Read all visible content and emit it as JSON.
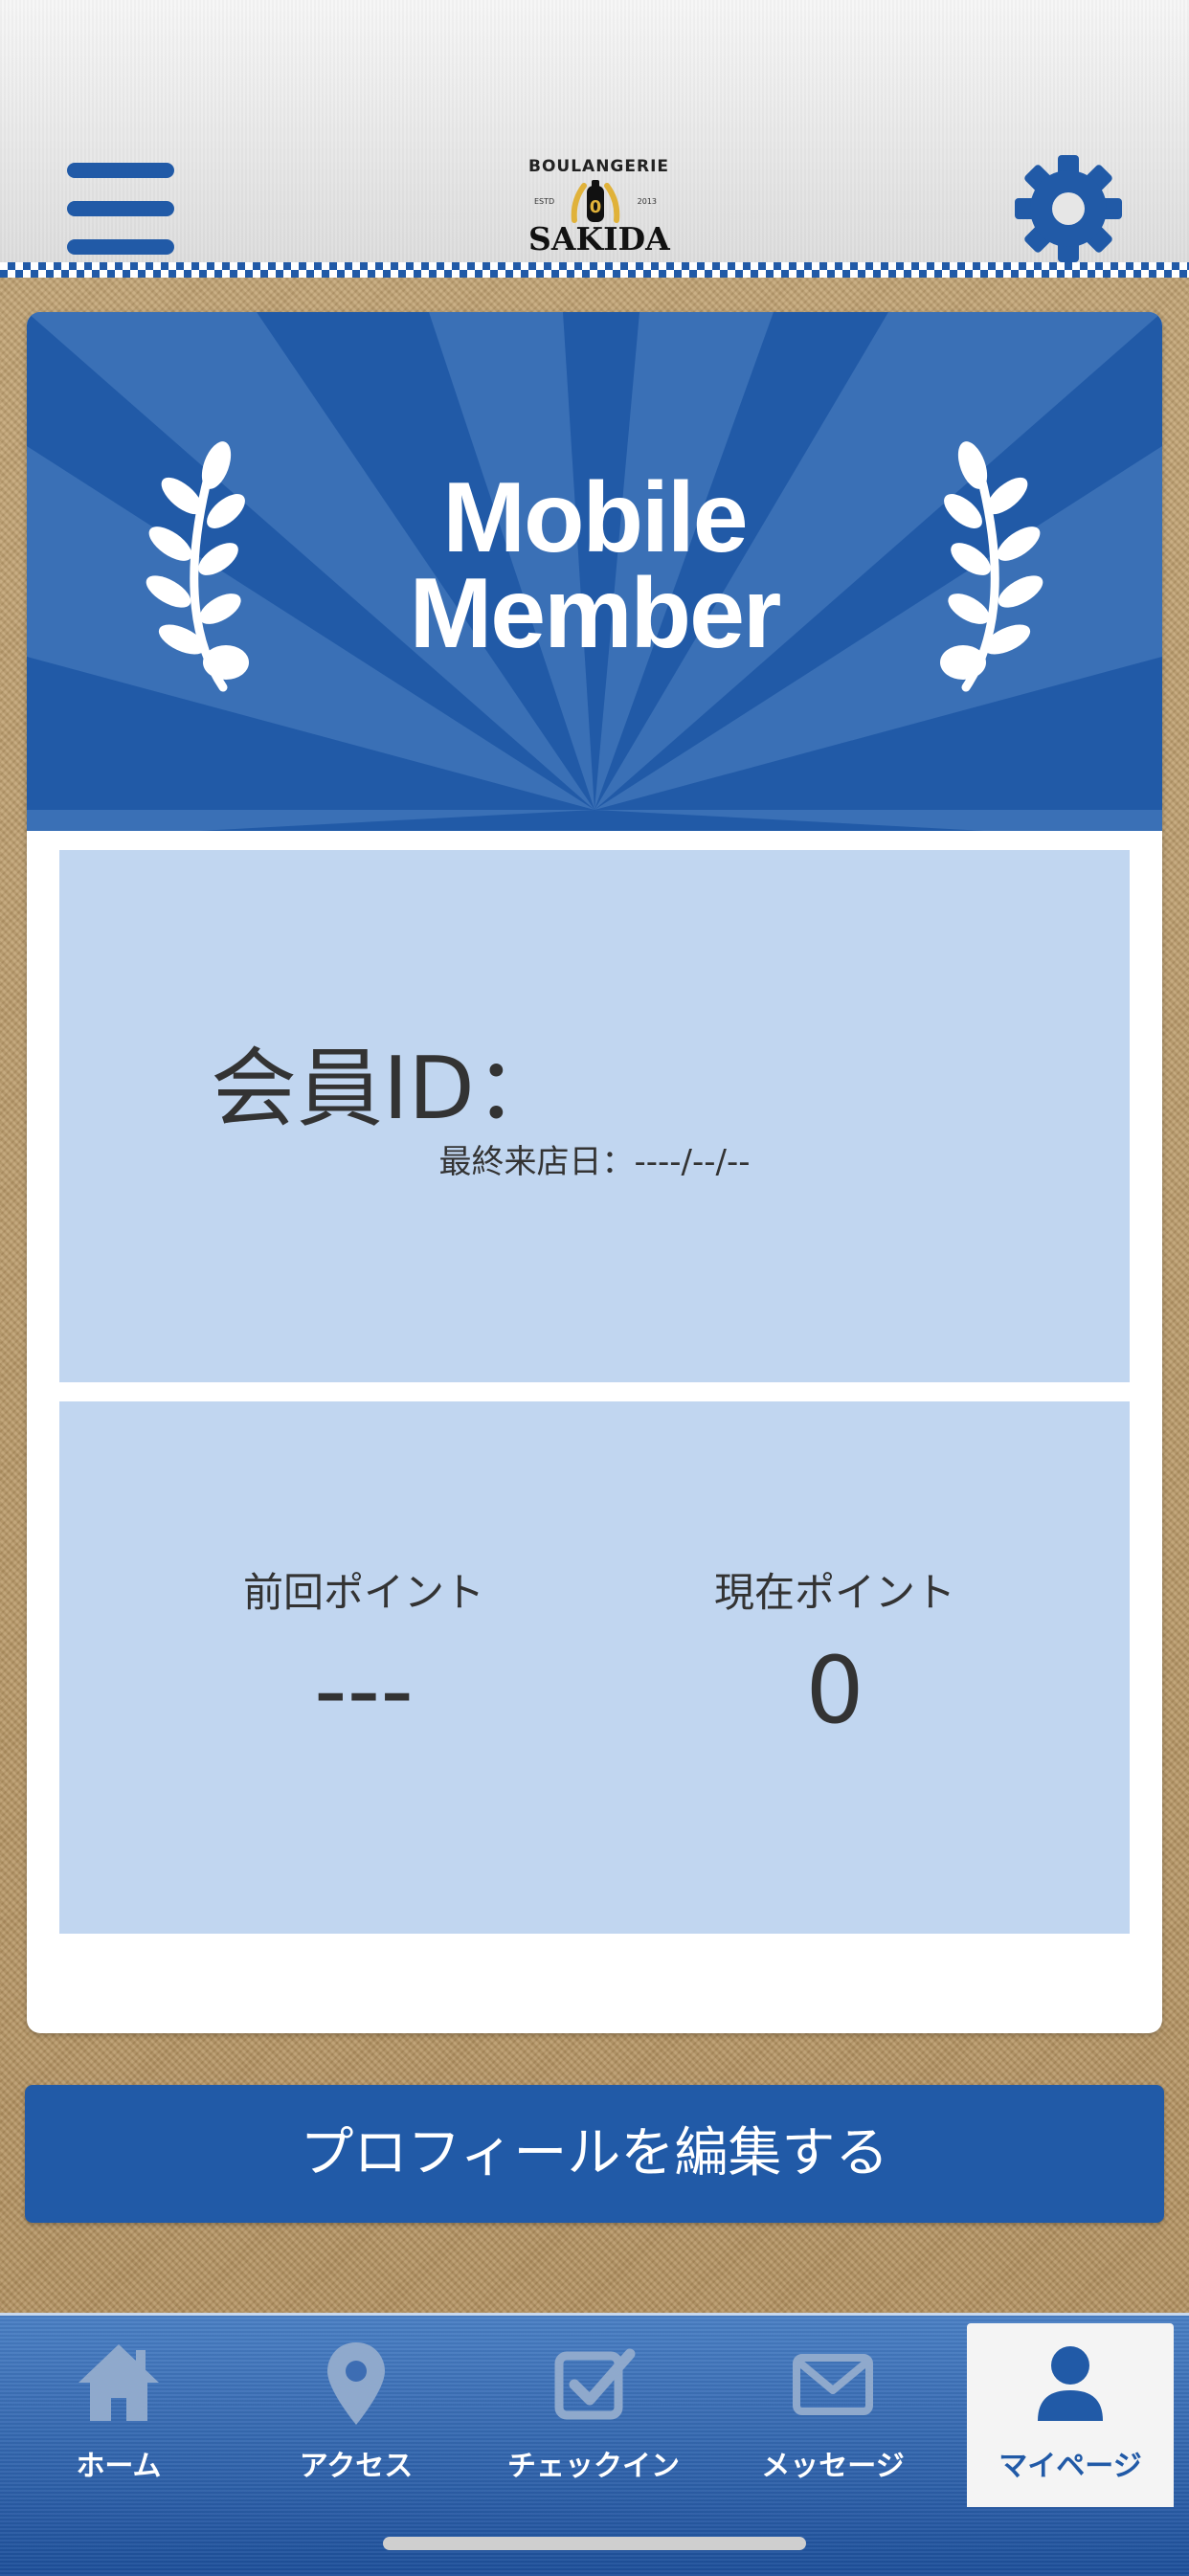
{
  "header": {
    "logo_top": "BOULANGERIE",
    "logo_name": "SAKIDA",
    "logo_estd": "ESTD",
    "logo_year": "2013",
    "menu_icon": "hamburger-menu-icon",
    "settings_icon": "gear-icon"
  },
  "member_card": {
    "banner_title_line1": "Mobile",
    "banner_title_line2": "Member",
    "member_id_label": "会員ID：",
    "last_visit": "最終来店日：----/--/--",
    "previous_points_label": "前回ポイント",
    "previous_points_value": "---",
    "current_points_label": "現在ポイント",
    "current_points_value": "0"
  },
  "edit_profile_button": "プロフィールを編集する",
  "bottom_nav": {
    "items": [
      {
        "label": "ホーム",
        "icon": "home-icon"
      },
      {
        "label": "アクセス",
        "icon": "map-pin-icon"
      },
      {
        "label": "チェックイン",
        "icon": "checkbox-icon"
      },
      {
        "label": "メッセージ",
        "icon": "envelope-icon"
      },
      {
        "label": "マイページ",
        "icon": "person-icon"
      }
    ],
    "active_index": 4
  },
  "colors": {
    "primary_blue": "#215aa7",
    "panel_blue": "#c1d6f0",
    "text_dark": "#333333"
  }
}
